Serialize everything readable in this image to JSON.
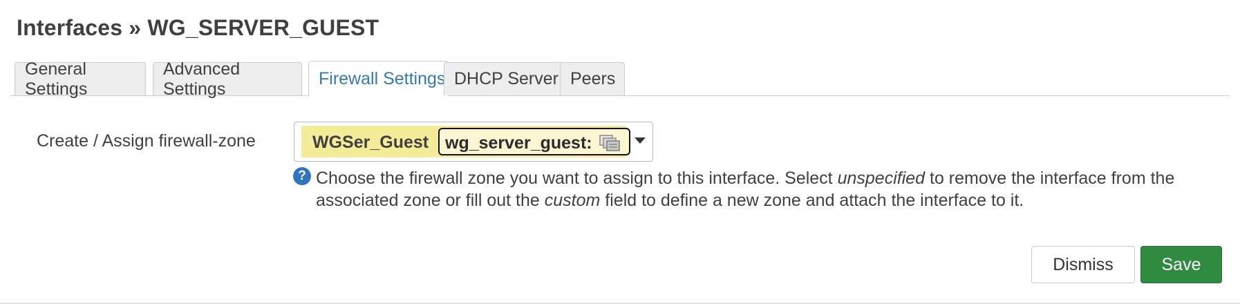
{
  "title": "Interfaces » WG_SERVER_GUEST",
  "tabs": [
    {
      "label": "General Settings",
      "active": false
    },
    {
      "label": "Advanced Settings",
      "active": false
    },
    {
      "label": "Firewall Settings",
      "active": true
    },
    {
      "label": "DHCP Server",
      "active": false
    },
    {
      "label": "Peers",
      "active": false
    }
  ],
  "firewall_zone": {
    "label": "Create / Assign firewall-zone",
    "selected_zone": "WGSer_Guest",
    "custom_value": "wg_server_guest:",
    "help": {
      "part1": "Choose the firewall zone you want to assign to this interface. Select ",
      "em1": "unspecified",
      "part2": " to remove the interface from the associated zone or fill out the ",
      "em2": "custom",
      "part3": " field to define a new zone and attach the interface to it."
    }
  },
  "buttons": {
    "dismiss": "Dismiss",
    "save": "Save"
  },
  "colors": {
    "active_tab_text": "#337ab7",
    "selection_highlight": "#f5ec99",
    "save_button": "#2e8b3f",
    "help_icon": "#2f74c0"
  },
  "icons": {
    "help": "question-circle-icon",
    "dropdown": "caret-down-icon",
    "input_autofill": "stacked-cards-icon"
  }
}
